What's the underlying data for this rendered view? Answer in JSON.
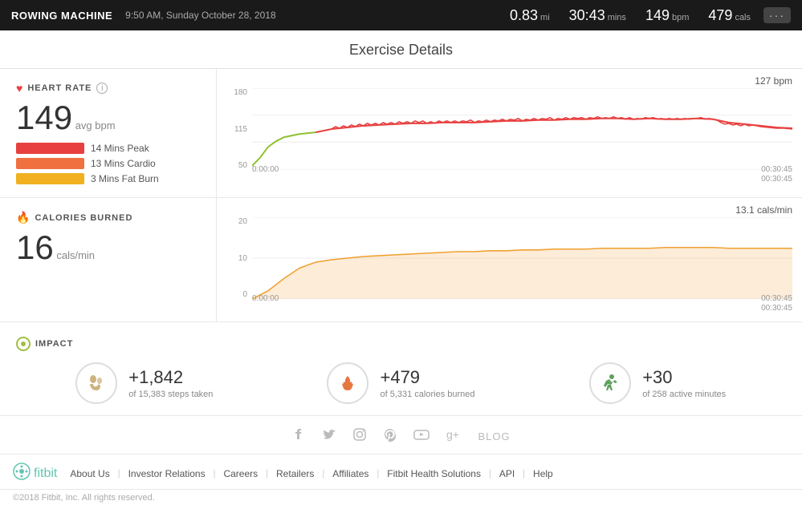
{
  "topbar": {
    "title": "ROWING MACHINE",
    "datetime": "9:50 AM, Sunday October 28, 2018",
    "stats": {
      "distance": {
        "value": "0.83",
        "unit": "mi"
      },
      "time": {
        "value": "30:43",
        "unit": "mins"
      },
      "bpm": {
        "value": "149",
        "unit": "bpm"
      },
      "cals": {
        "value": "479",
        "unit": "cals"
      }
    },
    "more_label": "···"
  },
  "page_title": "Exercise Details",
  "heart_rate": {
    "label": "HEART RATE",
    "avg_value": "149",
    "avg_unit": "avg bpm",
    "peak_label": "14 Mins Peak",
    "cardio_label": "13 Mins Cardio",
    "fatburn_label": "3 Mins Fat Burn",
    "chart_max": "127 bpm",
    "y_labels": [
      "180",
      "115",
      "50"
    ],
    "x_labels_left": "0:00:00",
    "x_labels_right": "00:30:45\n00:30:45"
  },
  "calories": {
    "label": "CALORIES BURNED",
    "value": "16",
    "unit": "cals/min",
    "chart_max": "13.1 cals/min",
    "y_labels": [
      "20",
      "10",
      "0"
    ],
    "x_labels_left": "0:00:00",
    "x_labels_right": "00:30:45\n00:30:45"
  },
  "impact": {
    "label": "IMPACT",
    "items": [
      {
        "delta": "+1,842",
        "desc": "of 15,383 steps taken",
        "icon": "🔥",
        "icon_name": "steps-icon"
      },
      {
        "delta": "+479",
        "desc": "of 5,331 calories burned",
        "icon": "🔥",
        "icon_name": "calories-icon"
      },
      {
        "delta": "+30",
        "desc": "of 258 active minutes",
        "icon": "🏃",
        "icon_name": "active-icon"
      }
    ]
  },
  "social": {
    "icons": [
      "facebook",
      "twitter",
      "instagram",
      "pinterest",
      "youtube",
      "google-plus"
    ],
    "blog_label": "BLOG"
  },
  "footer": {
    "links": [
      "About Us",
      "Investor Relations",
      "Careers",
      "Retailers",
      "Affiliates",
      "Fitbit Health Solutions",
      "API",
      "Help"
    ]
  },
  "copyright": "©2018 Fitbit, Inc. All rights reserved."
}
